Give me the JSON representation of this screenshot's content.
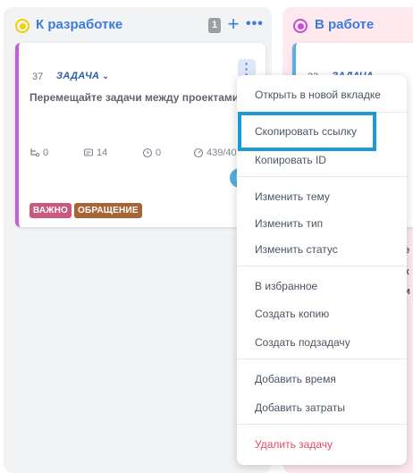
{
  "columns": [
    {
      "title": "К разработке",
      "dot_color": "#f1d100",
      "title_color": "#3d7bd9",
      "count": "1",
      "card": {
        "number": "37",
        "type": "ЗАДАЧА",
        "title": "Перемещайте задачи между проектами",
        "stats": {
          "subtasks": "0",
          "comments": "14",
          "time": "0",
          "progress": "439/40"
        },
        "avatar": "И",
        "tags": [
          {
            "label": "ВАЖНО",
            "color": "#c85a82"
          },
          {
            "label": "ОБРАЩЕНИЕ",
            "color": "#a76537"
          }
        ]
      }
    },
    {
      "title": "В работе",
      "dot_color": "#c44ed8",
      "title_color": "#3d7bd9",
      "card": {
        "number": "33",
        "type": "ЗАДАЧА"
      },
      "partial_texts": [
        "ю",
        "се",
        "ск",
        "си"
      ]
    }
  ],
  "context_menu": {
    "items": [
      "Открыть в новой вкладке",
      "Скопировать ссылку",
      "Копировать ID",
      "Изменить тему",
      "Изменить тип",
      "Изменить статус",
      "В избранное",
      "Создать копию",
      "Создать подзадачу",
      "Добавить время",
      "Добавить затраты",
      "Удалить задачу"
    ],
    "highlighted": "Скопировать ссылку"
  }
}
